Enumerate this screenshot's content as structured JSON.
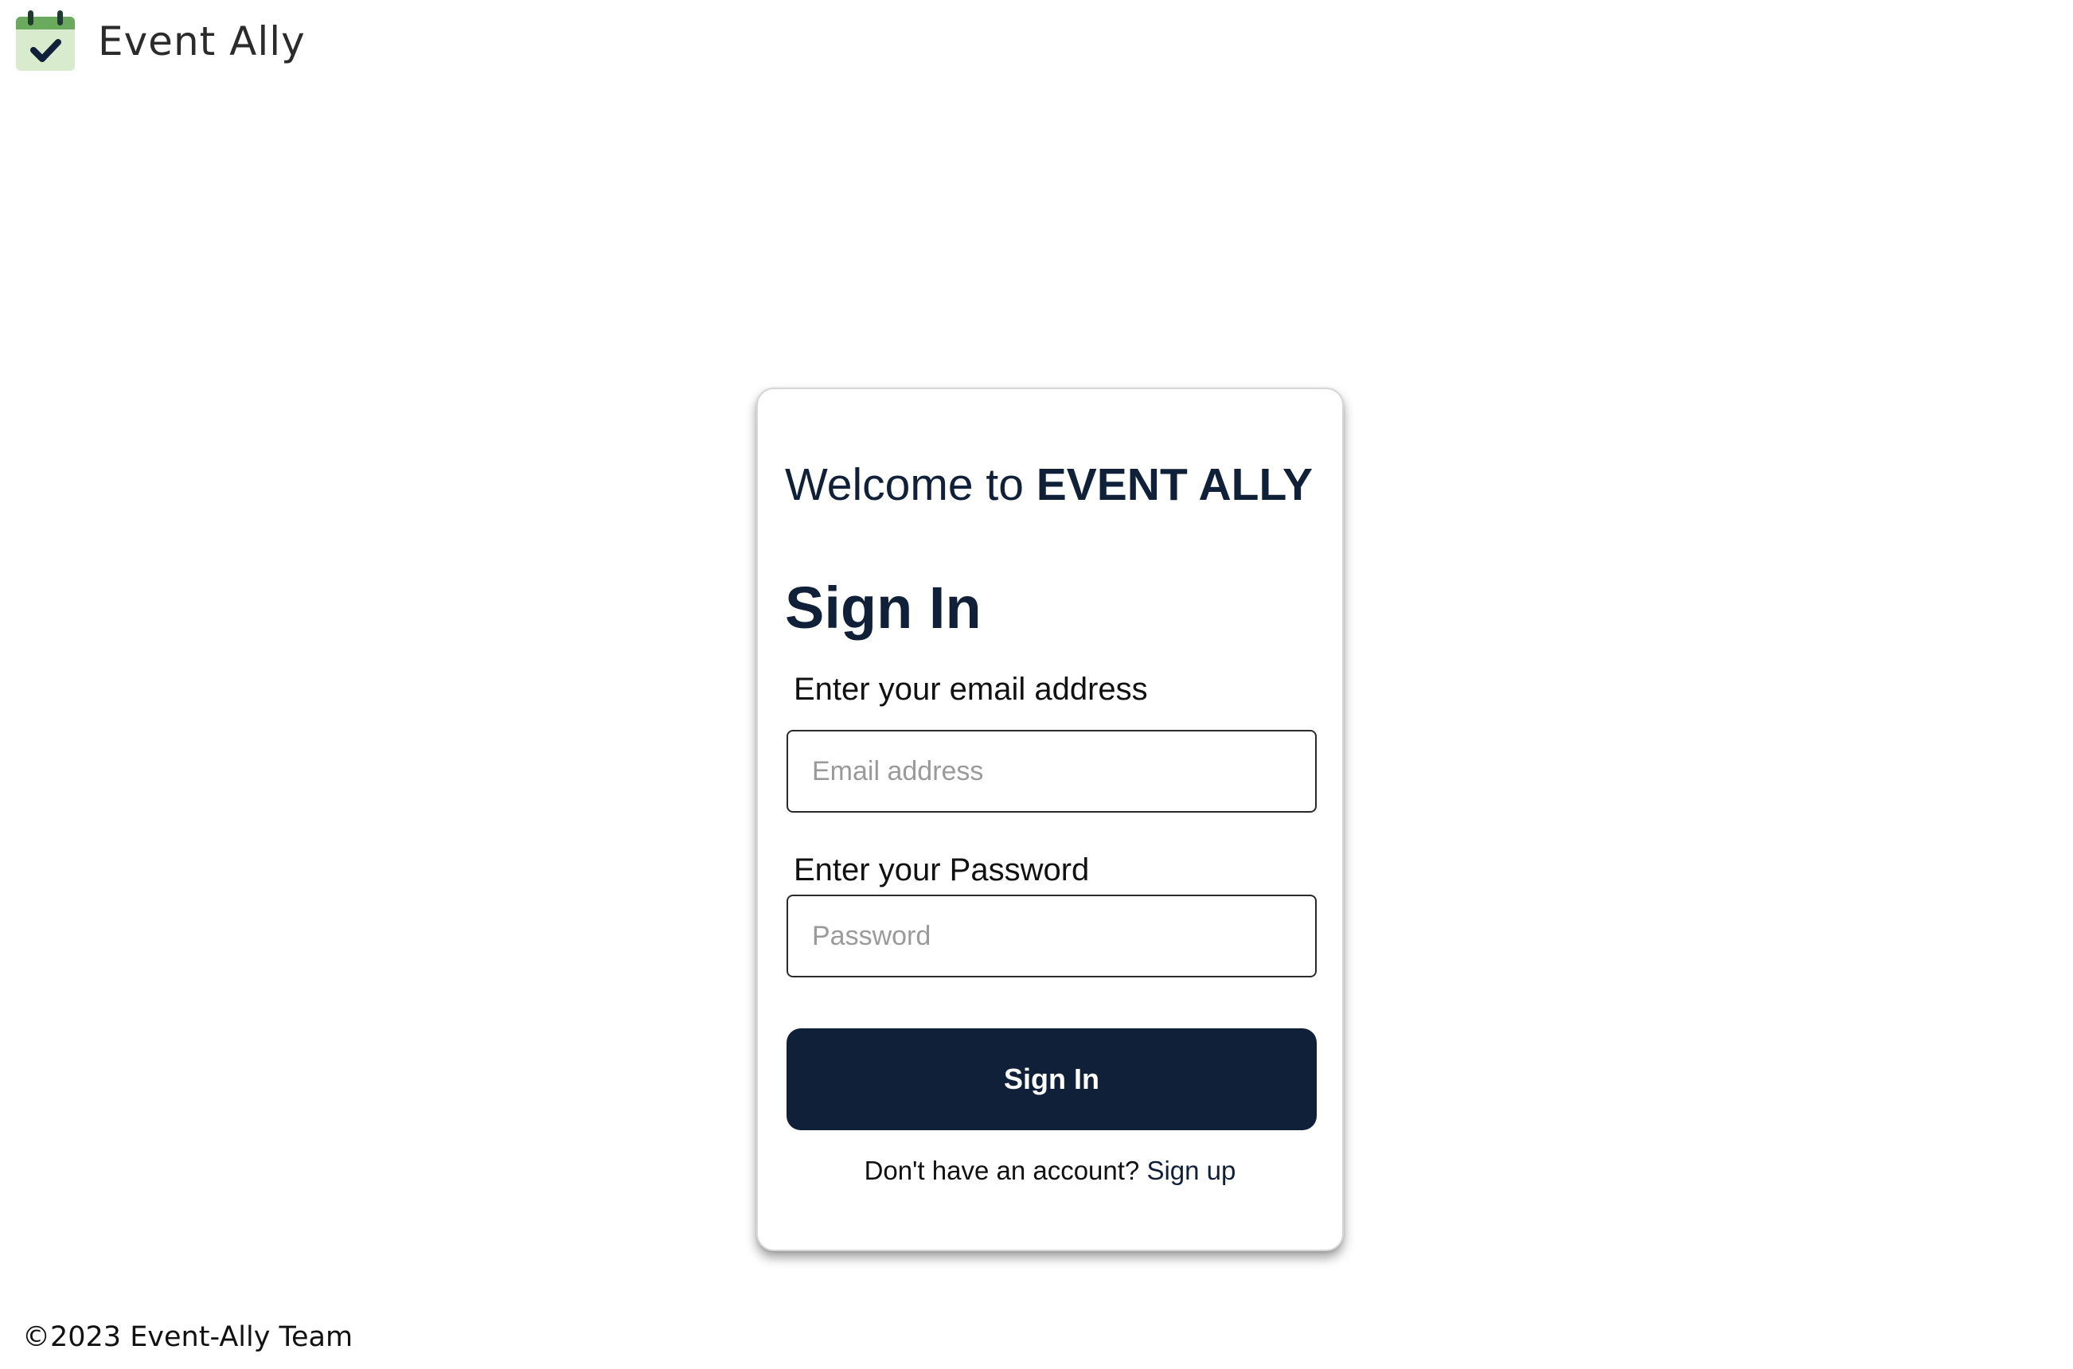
{
  "header": {
    "app_name": "Event Ally",
    "logo_icon": "calendar-check-icon",
    "logo_colors": {
      "top": "#6aaa5e",
      "body": "#d8eccd",
      "check": "#0f2038"
    }
  },
  "login_card": {
    "welcome_prefix": "Welcome to ",
    "welcome_brand": "EVENT ALLY",
    "title": "Sign In",
    "email": {
      "label": "Enter your email address",
      "placeholder": "Email address",
      "value": ""
    },
    "password": {
      "label": "Enter your Password",
      "placeholder": "Password",
      "value": ""
    },
    "submit_label": "Sign In",
    "signup_prompt": "Don't have an account? ",
    "signup_link": "Sign up"
  },
  "footer": {
    "copyright": "©2023 Event-Ally Team"
  },
  "colors": {
    "primary": "#102038",
    "text": "#0f2038",
    "placeholder": "#9a9a9a"
  }
}
